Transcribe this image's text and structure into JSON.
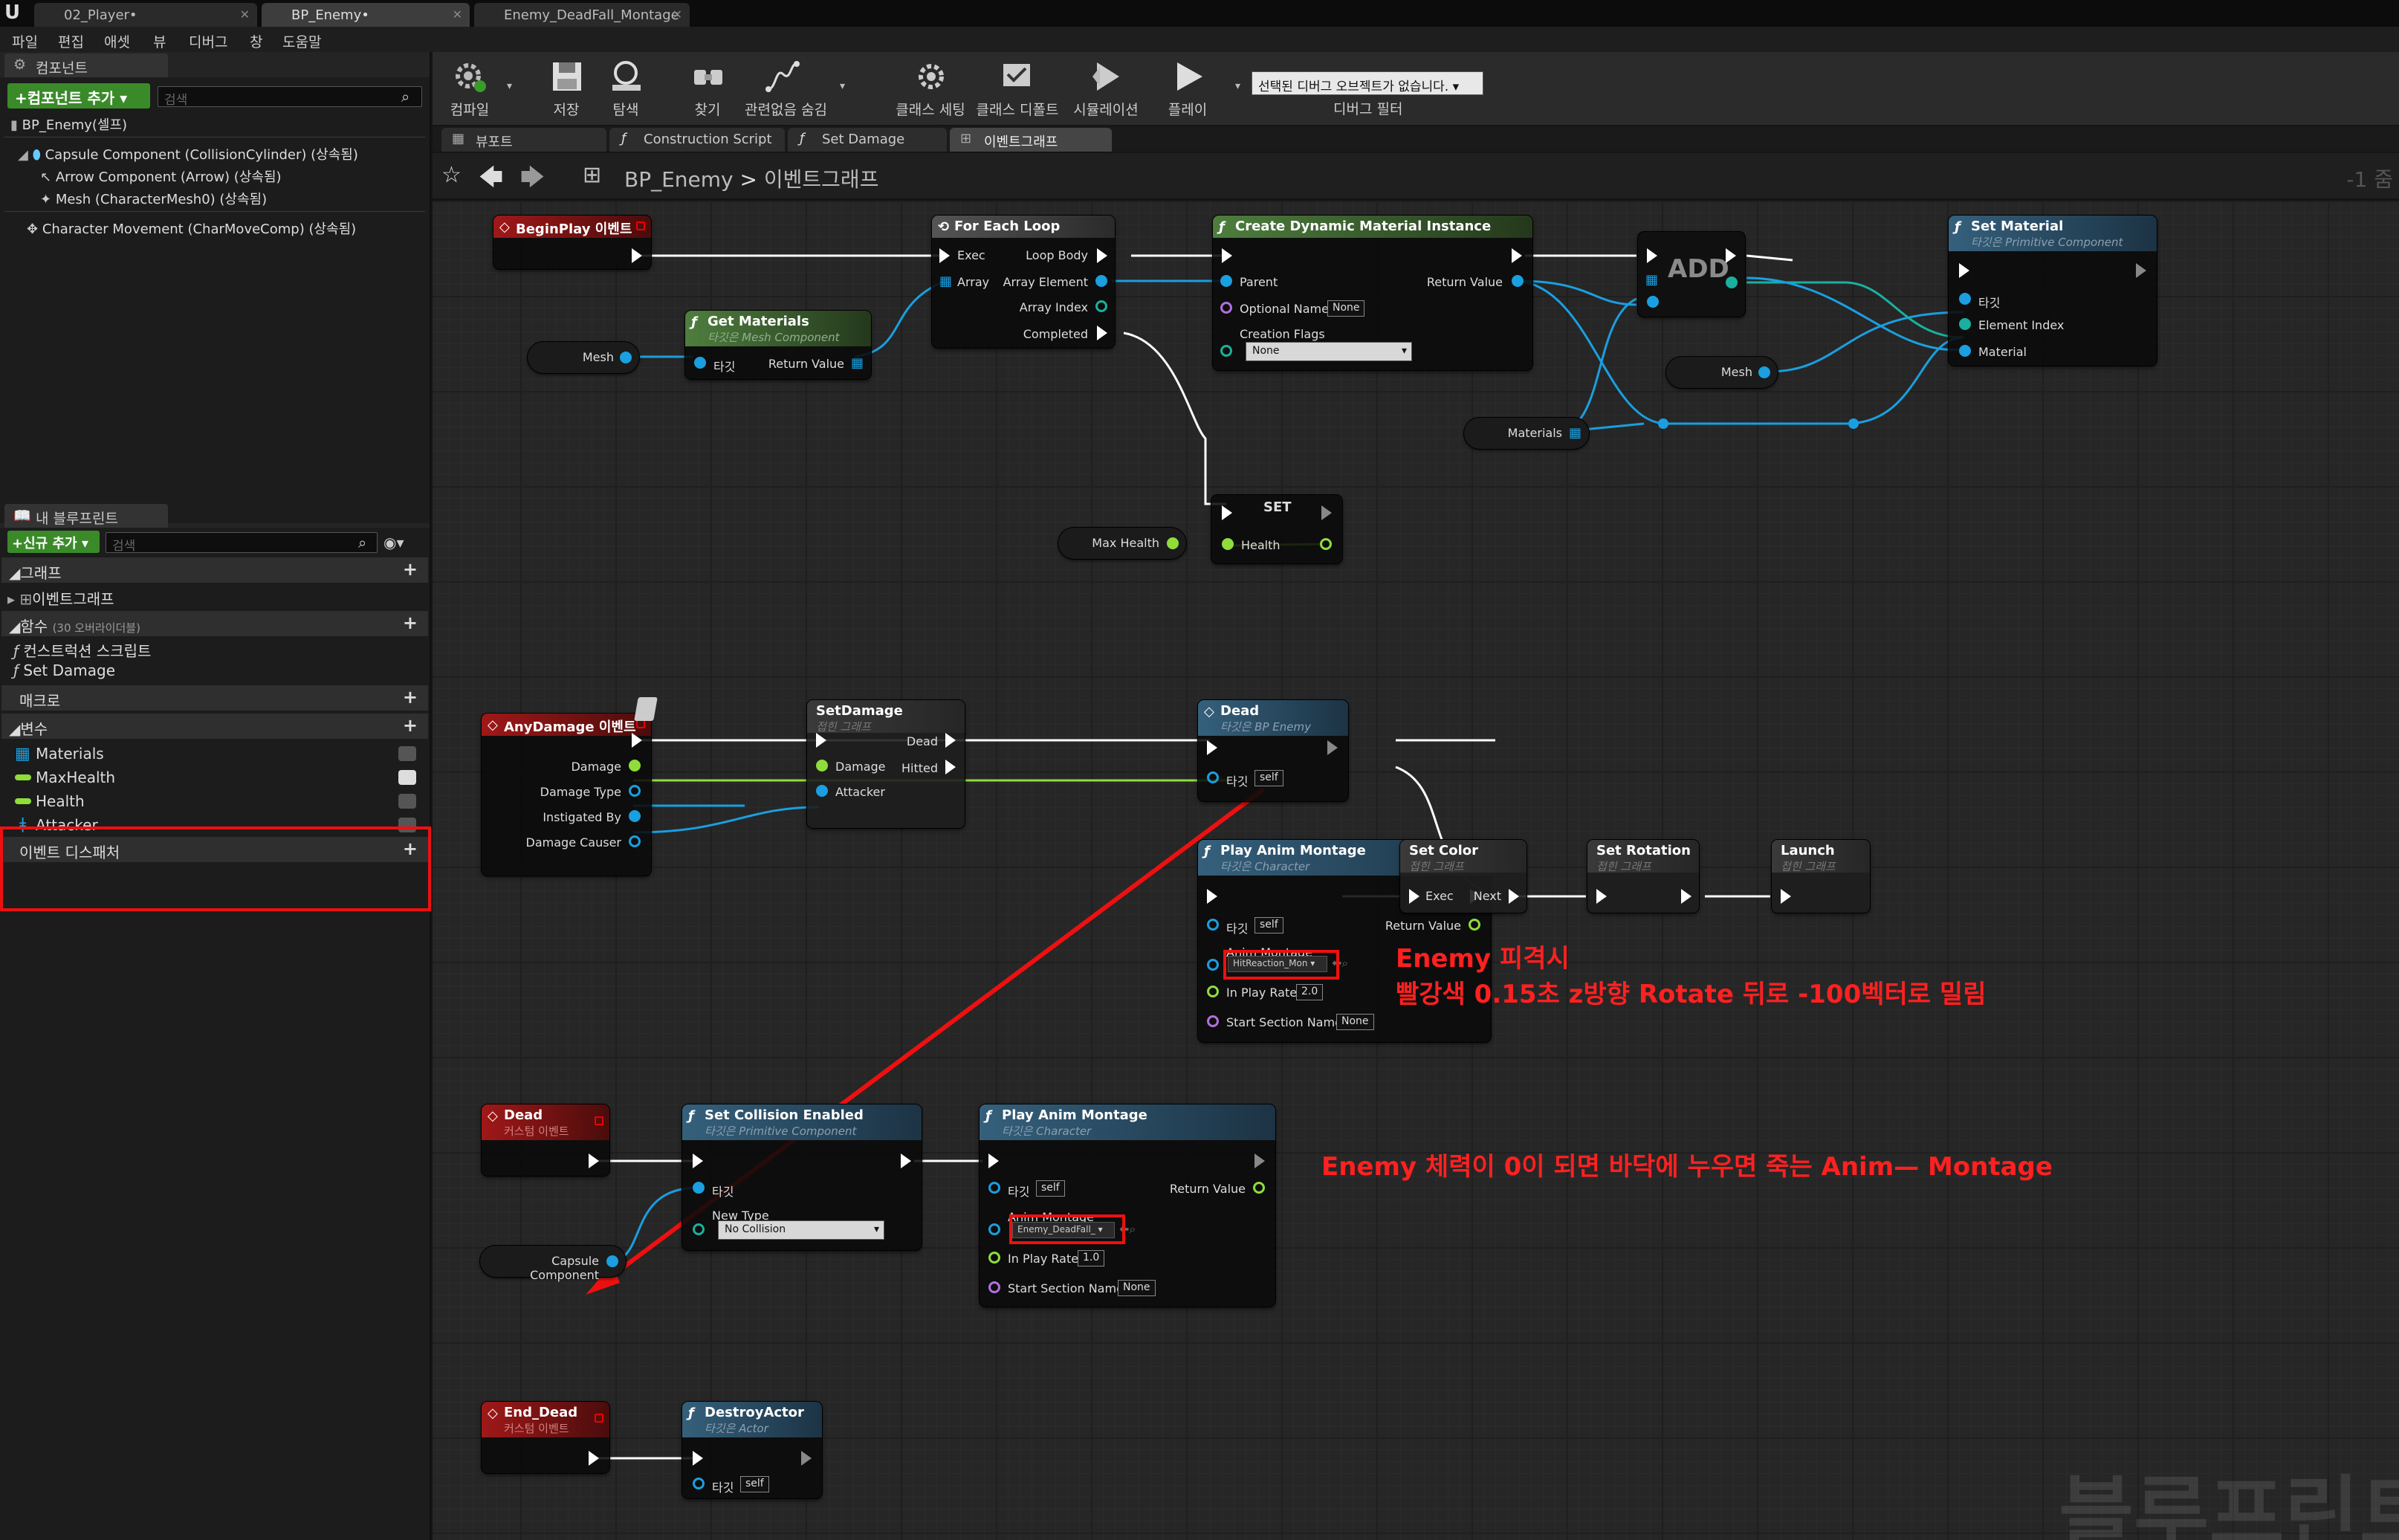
{
  "title_tabs": [
    "02_Player•",
    "BP_Enemy•",
    "Enemy_DeadFall_Montage"
  ],
  "menu": [
    "파일",
    "편집",
    "애셋",
    "뷰",
    "디버그",
    "창",
    "도움말"
  ],
  "components_panel": {
    "title": "컴포넌트",
    "add_button": "+컴포넌트 추가 ▾",
    "search_placeholder": "검색",
    "root": "BP_Enemy(셀프)",
    "items": [
      "Capsule Component (CollisionCylinder) (상속됨)",
      "Arrow Component (Arrow) (상속됨)",
      "Mesh (CharacterMesh0) (상속됨)",
      "Character Movement (CharMoveComp) (상속됨)"
    ]
  },
  "my_blueprint": {
    "title": "내 블루프린트",
    "add_button": "+신규 추가 ▾",
    "search_placeholder": "검색",
    "graphs_label": "그래프",
    "event_graph": "이벤트그래프",
    "functions_label": "함수",
    "functions_count": "(30 오버라이더블)",
    "functions": [
      "컨스트럭션 스크립트",
      "Set Damage"
    ],
    "macros_label": "매크로",
    "variables_label": "변수",
    "variables": [
      {
        "name": "Materials",
        "color": "#1a9fe0"
      },
      {
        "name": "MaxHealth",
        "color": "#8fdd3a"
      },
      {
        "name": "Health",
        "color": "#8fdd3a"
      },
      {
        "name": "Attacker",
        "color": "#1a9fe0"
      }
    ],
    "dispatchers_label": "이벤트 디스패처"
  },
  "toolbar": [
    {
      "label": "컴파일",
      "icon": "compile-icon"
    },
    {
      "label": "저장",
      "icon": "save-icon"
    },
    {
      "label": "탐색",
      "icon": "browse-icon"
    },
    {
      "label": "찾기",
      "icon": "find-icon"
    },
    {
      "label": "관련없음 숨김",
      "icon": "hide-unrelated-icon"
    },
    {
      "label": "클래스 세팅",
      "icon": "class-settings-icon"
    },
    {
      "label": "클래스 디폴트",
      "icon": "class-defaults-icon"
    },
    {
      "label": "시뮬레이션",
      "icon": "simulation-icon"
    },
    {
      "label": "플레이",
      "icon": "play-icon"
    }
  ],
  "debug_filter": {
    "value": "선택된 디버그 오브젝트가 없습니다.",
    "label": "디버그 필터"
  },
  "graph_tabs": [
    "뷰포트",
    "Construction Script",
    "Set Damage",
    "이벤트그래프"
  ],
  "breadcrumb": {
    "root": "BP_Enemy",
    "sep": ">",
    "current": "이벤트그래프",
    "zoom": "-1 줌"
  },
  "nodes": {
    "beginplay": {
      "title": "BeginPlay 이벤트"
    },
    "foreach": {
      "title": "For Each Loop",
      "exec": "Exec",
      "array": "Array",
      "loop_body": "Loop Body",
      "array_element": "Array Element",
      "array_index": "Array Index",
      "completed": "Completed"
    },
    "cdmi": {
      "title": "Create Dynamic Material Instance",
      "parent": "Parent",
      "return_value": "Return Value",
      "optional_name": "Optional Name",
      "optional_name_value": "None",
      "creation_flags": "Creation Flags",
      "creation_flags_value": "None"
    },
    "add": {
      "title": "ADD"
    },
    "setmaterial": {
      "title": "Set Material",
      "subtitle": "타깃은 Primitive Component",
      "target": "타깃",
      "element_index": "Element Index",
      "material": "Material"
    },
    "getmaterials": {
      "title": "Get Materials",
      "subtitle": "타깃은 Mesh Component",
      "target": "타깃",
      "return_value": "Return Value"
    },
    "mesh1": "Mesh",
    "mesh2": "Mesh",
    "materials_var": "Materials",
    "set": {
      "title": "SET",
      "health": "Health"
    },
    "maxhealth_var": "Max Health",
    "anydamage": {
      "title": "AnyDamage 이벤트",
      "damage": "Damage",
      "damage_type": "Damage Type",
      "instigated_by": "Instigated By",
      "damage_causer": "Damage Causer"
    },
    "setdamage": {
      "title": "SetDamage",
      "subtitle": "접힌 그래프",
      "damage": "Damage",
      "attacker": "Attacker",
      "dead": "Dead",
      "hitted": "Hitted"
    },
    "dead_call": {
      "title": "Dead",
      "subtitle": "타깃은 BP Enemy",
      "target": "타깃",
      "self": "self"
    },
    "pam1": {
      "title": "Play Anim Montage",
      "subtitle": "타깃은 Character",
      "target": "타깃",
      "self": "self",
      "return_value": "Return Value",
      "anim_montage": "Anim Montage",
      "anim_montage_value": "HitReaction_Mon",
      "in_play_rate": "In Play Rate",
      "in_play_rate_value": "2.0",
      "start_section": "Start Section Name",
      "start_section_value": "None"
    },
    "setcolor": {
      "title": "Set Color",
      "subtitle": "접힌 그래프",
      "exec": "Exec",
      "next": "Next"
    },
    "setrotation": {
      "title": "Set Rotation",
      "subtitle": "접힌 그래프"
    },
    "launch": {
      "title": "Launch",
      "subtitle": "접힌 그래프"
    },
    "dead_event": {
      "title": "Dead",
      "subtitle": "커스텀 이벤트"
    },
    "setcollision": {
      "title": "Set Collision Enabled",
      "subtitle": "타깃은 Primitive Component",
      "target": "타깃",
      "new_type": "New Type",
      "new_type_value": "No Collision"
    },
    "capsule_var": "Capsule Component",
    "pam2": {
      "title": "Play Anim Montage",
      "subtitle": "타깃은 Character",
      "target": "타깃",
      "self": "self",
      "return_value": "Return Value",
      "anim_montage": "Anim Montage",
      "anim_montage_value": "Enemy_DeadFall_",
      "in_play_rate": "In Play Rate",
      "in_play_rate_value": "1.0",
      "start_section": "Start Section Name",
      "start_section_value": "None"
    },
    "enddead": {
      "title": "End_Dead",
      "subtitle": "커스텀 이벤트"
    },
    "destroy": {
      "title": "DestroyActor",
      "subtitle": "타깃은 Actor",
      "target": "타깃",
      "self": "self"
    }
  },
  "annotations": {
    "line1": "Enemy 피격시",
    "line2": "빨강색 0.15초   z방향 Rotate      뒤로 -100벡터로 밀림",
    "line3": "Enemy 체력이 0이 되면 바닥에 누우면 죽는 Anim— Montage",
    "color": "#ff2020"
  },
  "watermark": "블루프린트"
}
